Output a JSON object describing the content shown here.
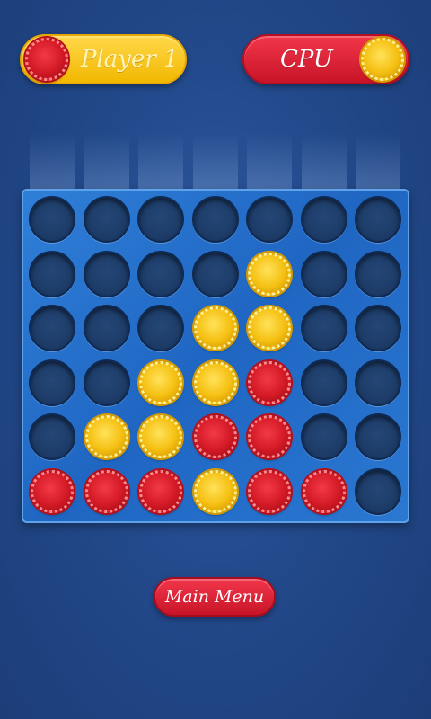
{
  "players": {
    "player1": {
      "label": "Player 1",
      "chip": "red"
    },
    "cpu": {
      "label": "CPU",
      "chip": "yellow"
    }
  },
  "colors": {
    "red": "#d41a26",
    "yellow": "#f5c012",
    "board": "#2470cc",
    "background": "#234a8c"
  },
  "board": {
    "columns": 7,
    "rows": 6,
    "grid": [
      [
        "empty",
        "empty",
        "empty",
        "empty",
        "empty",
        "empty",
        "empty"
      ],
      [
        "empty",
        "empty",
        "empty",
        "empty",
        "yellow",
        "empty",
        "empty"
      ],
      [
        "empty",
        "empty",
        "empty",
        "yellow",
        "yellow",
        "empty",
        "empty"
      ],
      [
        "empty",
        "empty",
        "yellow",
        "yellow",
        "red",
        "empty",
        "empty"
      ],
      [
        "empty",
        "yellow",
        "yellow",
        "red",
        "red",
        "empty",
        "empty"
      ],
      [
        "red",
        "red",
        "red",
        "yellow",
        "red",
        "red",
        "empty"
      ]
    ]
  },
  "menu": {
    "main_menu_label": "Main Menu"
  }
}
